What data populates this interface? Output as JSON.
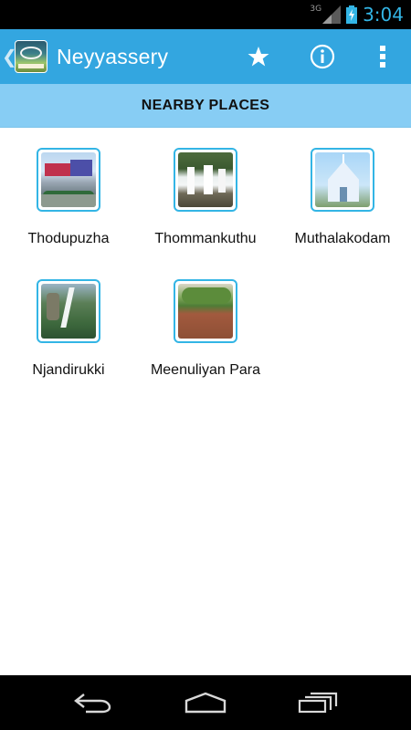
{
  "status_bar": {
    "network": "3G",
    "time": "3:04"
  },
  "action_bar": {
    "title": "Neyyassery",
    "up_icon": "chevron-left-icon",
    "actions": [
      {
        "name": "favorite",
        "icon": "star-icon"
      },
      {
        "name": "info",
        "icon": "info-icon"
      },
      {
        "name": "overflow",
        "icon": "overflow-menu-icon"
      }
    ]
  },
  "section": {
    "title": "NEARBY PLACES"
  },
  "places": [
    {
      "name": "Thodupuzha"
    },
    {
      "name": "Thommankuthu"
    },
    {
      "name": "Muthalakodam"
    },
    {
      "name": "Njandirukki"
    },
    {
      "name": "Meenuliyan Para"
    }
  ],
  "nav_bar": {
    "buttons": [
      {
        "name": "back",
        "icon": "back-icon"
      },
      {
        "name": "home",
        "icon": "home-icon"
      },
      {
        "name": "recents",
        "icon": "recent-apps-icon"
      }
    ]
  },
  "colors": {
    "action_bar": "#33a6e0",
    "section_header": "#87cdf4",
    "accent": "#33b5e5"
  }
}
